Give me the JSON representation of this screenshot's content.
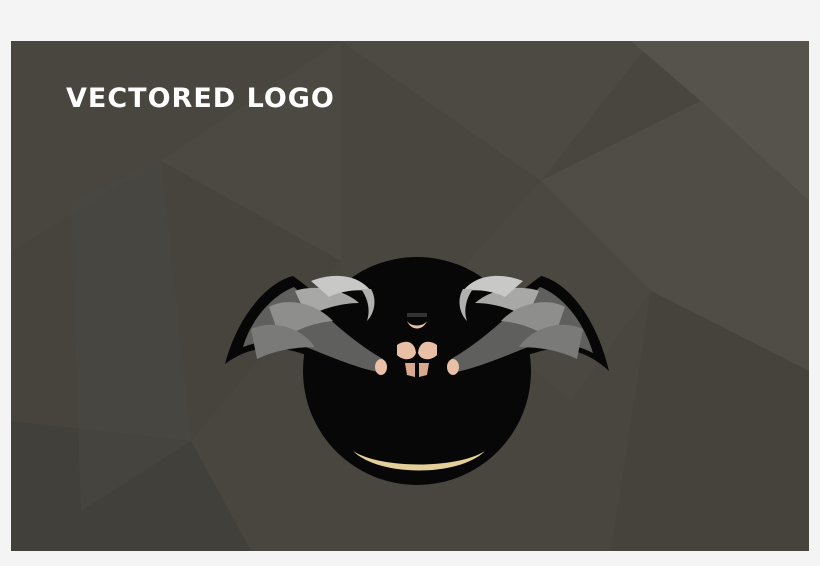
{
  "banner": {
    "title": "VECTORED LOGO"
  },
  "emblem": {
    "icon": "winged-man-mascot-icon",
    "colors": {
      "background": "#48463f",
      "circle": "#070707",
      "wing_light": "#9a9a98",
      "wing_dark": "#5f5f5d",
      "skin": "#e9bfa6",
      "crescent": "#e3cf97"
    }
  }
}
